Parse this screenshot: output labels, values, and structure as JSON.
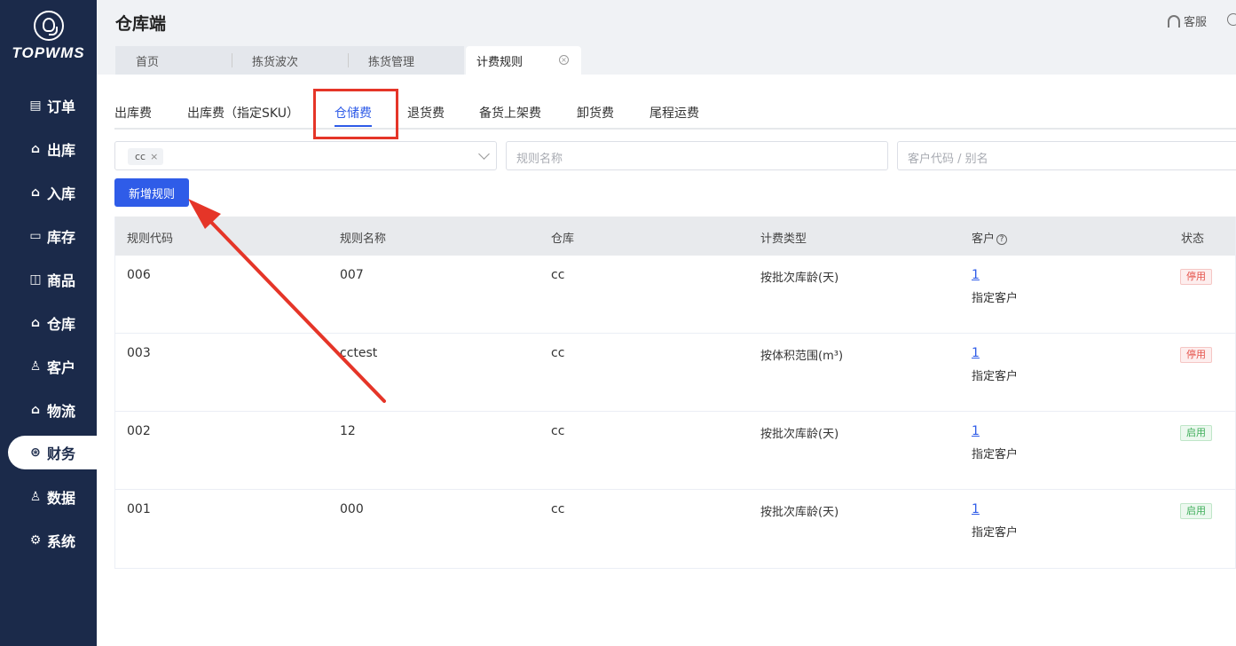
{
  "app": {
    "logo_text": "TOPWMS",
    "page_title": "仓库端",
    "service_label": "客服"
  },
  "nav": [
    {
      "label": "订单",
      "icon": "document-icon"
    },
    {
      "label": "出库",
      "icon": "outbound-icon"
    },
    {
      "label": "入库",
      "icon": "inbound-icon"
    },
    {
      "label": "库存",
      "icon": "inventory-icon"
    },
    {
      "label": "商品",
      "icon": "bag-icon"
    },
    {
      "label": "仓库",
      "icon": "warehouse-icon"
    },
    {
      "label": "客户",
      "icon": "user-icon"
    },
    {
      "label": "物流",
      "icon": "logistics-icon"
    },
    {
      "label": "财务",
      "icon": "finance-icon",
      "active": true
    },
    {
      "label": "数据",
      "icon": "data-icon"
    },
    {
      "label": "系统",
      "icon": "settings-icon"
    }
  ],
  "tabs": [
    "首页",
    "拣货波次",
    "拣货管理",
    "计费规则"
  ],
  "subtabs": [
    "出库费",
    "出库费（指定SKU）",
    "仓储费",
    "退货费",
    "备货上架费",
    "卸货费",
    "尾程运费"
  ],
  "filters": {
    "warehouse_tag": "cc",
    "rule_name_placeholder": "规则名称",
    "customer_placeholder": "客户代码 / 别名"
  },
  "add_button": "新增规则",
  "table": {
    "headers": [
      "规则代码",
      "规则名称",
      "仓库",
      "计费类型",
      "客户",
      "状态"
    ],
    "rows": [
      {
        "code": "006",
        "name": "007",
        "warehouse": "cc",
        "type": "按批次库龄(天)",
        "customer_count": "1",
        "customer_type": "指定客户",
        "status": "停用"
      },
      {
        "code": "003",
        "name": "cctest",
        "warehouse": "cc",
        "type": "按体积范围(m³)",
        "customer_count": "1",
        "customer_type": "指定客户",
        "status": "停用"
      },
      {
        "code": "002",
        "name": "12",
        "warehouse": "cc",
        "type": "按批次库龄(天)",
        "customer_count": "1",
        "customer_type": "指定客户",
        "status": "启用"
      },
      {
        "code": "001",
        "name": "000",
        "warehouse": "cc",
        "type": "按批次库龄(天)",
        "customer_count": "1",
        "customer_type": "指定客户",
        "status": "启用"
      }
    ]
  },
  "colors": {
    "sidebar": "#1b2a4a",
    "accent": "#2f5ce8",
    "highlight": "#e53528"
  }
}
